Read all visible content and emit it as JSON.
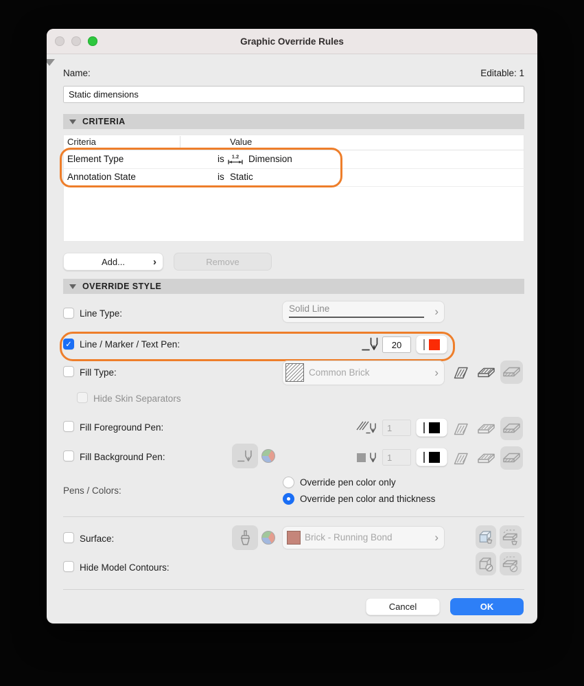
{
  "window": {
    "title": "Graphic Override Rules"
  },
  "name_row": {
    "label": "Name:",
    "editable": "Editable: 1",
    "value": "Static dimensions"
  },
  "criteria": {
    "header": "CRITERIA",
    "col_criteria": "Criteria",
    "col_value": "Value",
    "rows": [
      {
        "name": "Element Type",
        "op": "is",
        "value": "Dimension"
      },
      {
        "name": "Annotation State",
        "op": "is",
        "value": "Static"
      }
    ],
    "add": "Add...",
    "remove": "Remove"
  },
  "override": {
    "header": "OVERRIDE STYLE",
    "line_type_label": "Line Type:",
    "line_type_value": "Solid Line",
    "pen_label": "Line / Marker / Text Pen:",
    "pen_value": "20",
    "fill_type_label": "Fill Type:",
    "fill_type_value": "Common Brick",
    "hide_skin_label": "Hide Skin Separators",
    "fill_fg_label": "Fill Foreground Pen:",
    "fill_fg_value": "1",
    "fill_bg_label": "Fill Background Pen:",
    "fill_bg_value": "1",
    "pens_colors_label": "Pens / Colors:",
    "radio_options": [
      "Override pen color only",
      "Override pen color and thickness"
    ],
    "surface_label": "Surface:",
    "surface_value": "Brick - Running Bond",
    "hide_contours_label": "Hide Model Contours:"
  },
  "footer": {
    "cancel": "Cancel",
    "ok": "OK"
  },
  "glyphs": {
    "chevron": "›",
    "check": "✓",
    "dim_text": "1.2"
  },
  "colors": {
    "highlight_orange": "#ee7e2a",
    "pen_red": "#fb2b05",
    "accent_blue": "#1a6ef5",
    "ok_blue": "#2d7ff7",
    "surface_swatch": "#c5857a",
    "pen_black": "#000000"
  }
}
